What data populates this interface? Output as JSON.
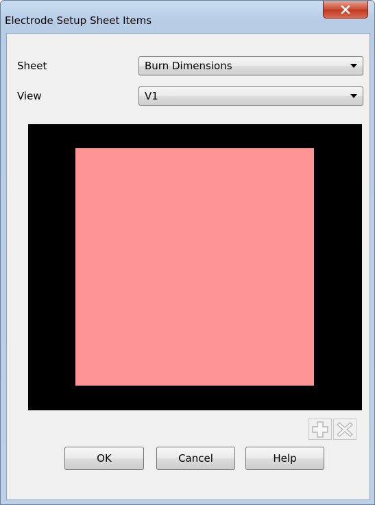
{
  "window": {
    "title": "Electrode Setup Sheet Items"
  },
  "form": {
    "sheet_label": "Sheet",
    "sheet_value": "Burn Dimensions",
    "view_label": "View",
    "view_value": "V1"
  },
  "preview": {
    "background_color": "#000000",
    "shape_color": "#ff9494"
  },
  "toolbar": {
    "add_icon": "plus-icon",
    "delete_icon": "delete-x-icon"
  },
  "buttons": {
    "ok": "OK",
    "cancel": "Cancel",
    "help": "Help"
  }
}
